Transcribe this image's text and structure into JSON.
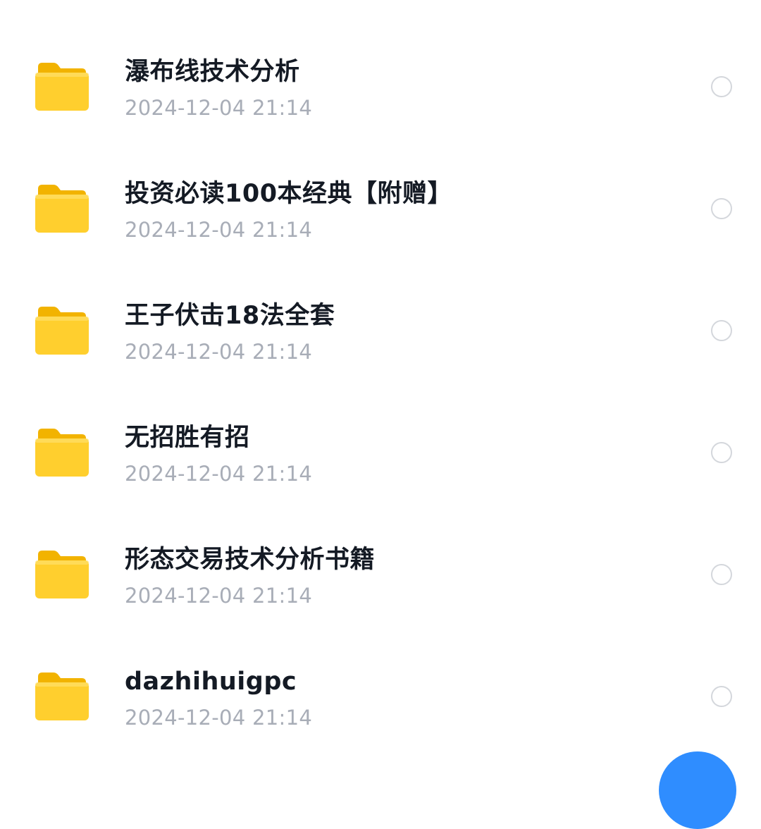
{
  "files": [
    {
      "name": "瀑布线技术分析",
      "date": "2024-12-04 21:14"
    },
    {
      "name": "投资必读100本经典【附赠】",
      "date": "2024-12-04 21:14"
    },
    {
      "name": "王子伏击18法全套",
      "date": "2024-12-04 21:14"
    },
    {
      "name": "无招胜有招",
      "date": "2024-12-04 21:14"
    },
    {
      "name": "形态交易技术分析书籍",
      "date": "2024-12-04 21:14"
    },
    {
      "name": "dazhihuigpc",
      "date": "2024-12-04 21:14"
    }
  ],
  "icons": {
    "folder": "folder-icon",
    "select": "radio-circle-icon"
  },
  "colors": {
    "folder": "#ffcf2e",
    "title_text": "#141a24",
    "date_text": "#a8adb7",
    "accent": "#2f8dff"
  }
}
